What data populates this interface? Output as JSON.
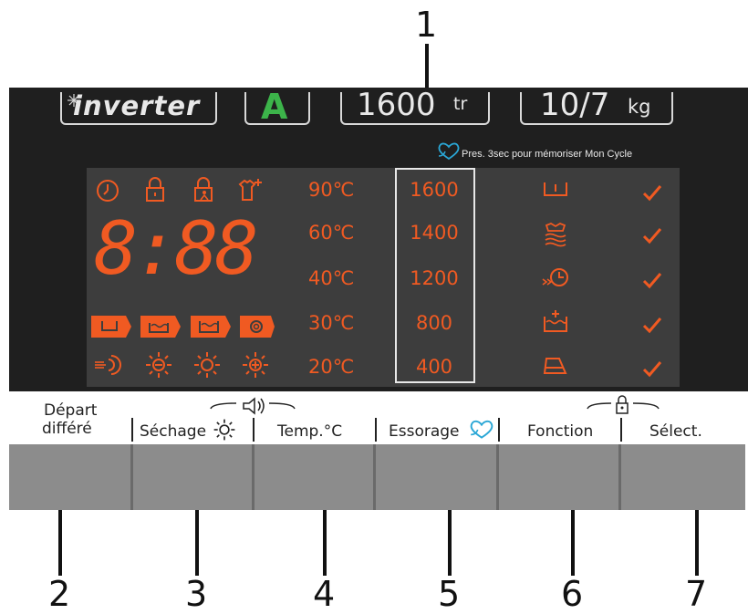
{
  "callouts": [
    "1",
    "2",
    "3",
    "4",
    "5",
    "6",
    "7"
  ],
  "header": {
    "brand": "inverter",
    "energy_class": "A",
    "speed_value": "1600",
    "speed_unit": "tr",
    "capacity_value": "10/7",
    "capacity_unit": "kg",
    "memory_hint": "Pres. 3sec pour mémoriser Mon Cycle"
  },
  "display": {
    "digits": "8:88",
    "temperatures": [
      "90℃",
      "60℃",
      "40℃",
      "30℃",
      "20℃"
    ],
    "spin_speeds": [
      "1600",
      "1400",
      "1200",
      "800",
      "400"
    ]
  },
  "buttons": [
    {
      "label_line1": "Départ",
      "label_line2": "différé"
    },
    {
      "label": "Séchage"
    },
    {
      "label": "Temp.°C"
    },
    {
      "label": "Essorage"
    },
    {
      "label": "Fonction"
    },
    {
      "label": "Sélect."
    }
  ],
  "icons": {
    "timer": "timer-icon",
    "lock": "lock-icon",
    "child_lock": "child-lock-icon",
    "shirt_plus": "shirt-plus-icon",
    "prewash": "prewash-icon",
    "wash": "wash-icon",
    "rinse": "rinse-icon",
    "spin": "spin-icon",
    "sound": "sound-icon",
    "heart": "heart-icon"
  },
  "colors": {
    "led_orange": "#f05a22",
    "panel_dark": "#1f1f1f",
    "lcd_gray": "#3d3d3d",
    "energy_green": "#3cb44a",
    "heart_cyan": "#2aa7d6"
  }
}
